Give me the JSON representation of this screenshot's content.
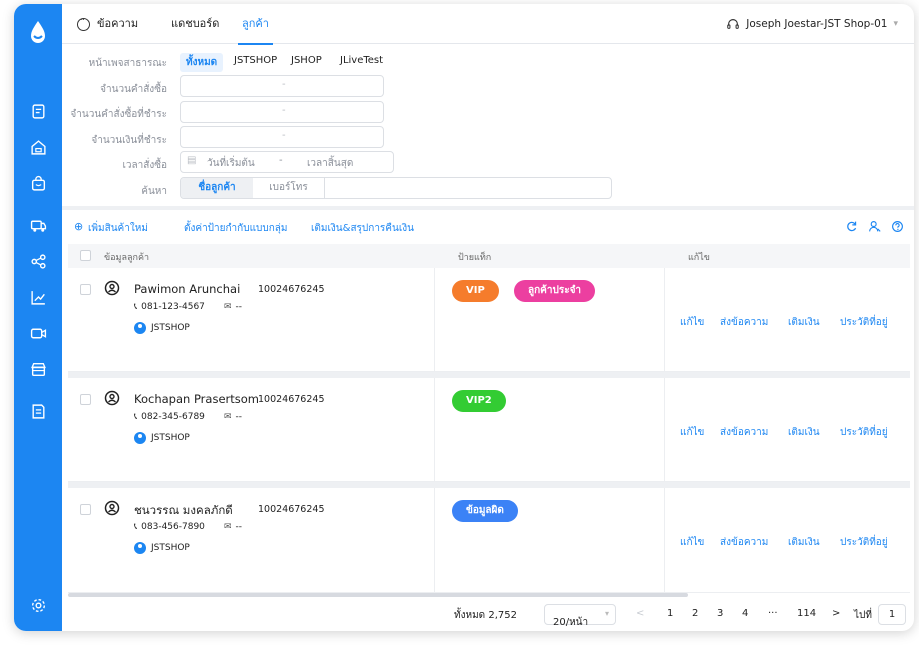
{
  "colors": {
    "brand": "#1c86f2",
    "tag_vip": "#f57c2c",
    "tag_regular": "#ec3fa0",
    "tag_vip2": "#33cc33",
    "tag_error": "#3b82f6"
  },
  "topnav": {
    "tabs": [
      "ข้อความ",
      "แดชบอร์ด",
      "ลูกค้า"
    ],
    "active_tab": "ลูกค้า",
    "user": "Joseph Joestar-JST Shop-01",
    "user_icon": "headset-icon"
  },
  "sidebar": {
    "icons": [
      "logo-drop-icon",
      "orders-icon",
      "home-icon",
      "bag-icon",
      "truck-icon",
      "share-icon",
      "chart-icon",
      "video-icon",
      "store-icon",
      "notes-icon",
      "settings-icon"
    ]
  },
  "filters": {
    "public_page_label": "หน้าเพจสาธารณะ",
    "pages": [
      "ทั้งหมด",
      "JSTSHOP",
      "JSHOP",
      "JLiveTest"
    ],
    "order_count_label": "จำนวนคำสั่งซื้อ",
    "paid_order_count_label": "จำนวนคำสั่งซื้อที่ชำระ",
    "paid_amount_label": "จำนวนเงินที่ชำระ",
    "range_separator": "-",
    "order_time_label": "เวลาสั่งซื้อ",
    "start_date_placeholder": "วันที่เริ่มต้น",
    "end_date_placeholder": "เวลาสิ้นสุด",
    "search_label": "ค้นหา",
    "search_modes": [
      "ชื่อลูกค้า",
      "เบอร์โทร"
    ]
  },
  "toolbar": {
    "add_product": "เพิ่มสินค้าใหม่",
    "set_tags": "ตั้งค่าป้ายกำกับแบบกลุ่ม",
    "refund": "เติมเงิน&สรุปการคืนเงิน"
  },
  "table": {
    "headers": {
      "customer": "ข้อมูลลูกค้า",
      "tags": "ป้ายแท็ก",
      "edit": "แก้ไข"
    },
    "actions": [
      "แก้ไข",
      "ส่งข้อความ",
      "เติมเงิน",
      "ประวัติที่อยู่"
    ],
    "rows": [
      {
        "name": "Pawimon Arunchai",
        "id": "10024676245",
        "phone": "081-123-4567",
        "email": "--",
        "shop": "JSTSHOP",
        "tags": [
          {
            "label": "VIP",
            "color": "#f57c2c"
          },
          {
            "label": "ลูกค้าประจำ",
            "color": "#ec3fa0"
          }
        ]
      },
      {
        "name": "Kochapan Prasertsom",
        "id": "10024676245",
        "phone": "082-345-6789",
        "email": "--",
        "shop": "JSTSHOP",
        "tags": [
          {
            "label": "VIP2",
            "color": "#33cc33"
          }
        ]
      },
      {
        "name": "ชนวรรณ มงคลภักดี",
        "id": "10024676245",
        "phone": "083-456-7890",
        "email": "--",
        "shop": "JSTSHOP",
        "tags": [
          {
            "label": "ข้อมูลผิด",
            "color": "#3b82f6"
          }
        ]
      }
    ]
  },
  "pagination": {
    "total": "ทั้งหมด 2,752",
    "page_size": "20/หน้า",
    "prev": "<",
    "pages": [
      "1",
      "2",
      "3",
      "4",
      "···",
      "114"
    ],
    "next": ">",
    "goto_label": "ไปที่",
    "goto_value": "1"
  }
}
